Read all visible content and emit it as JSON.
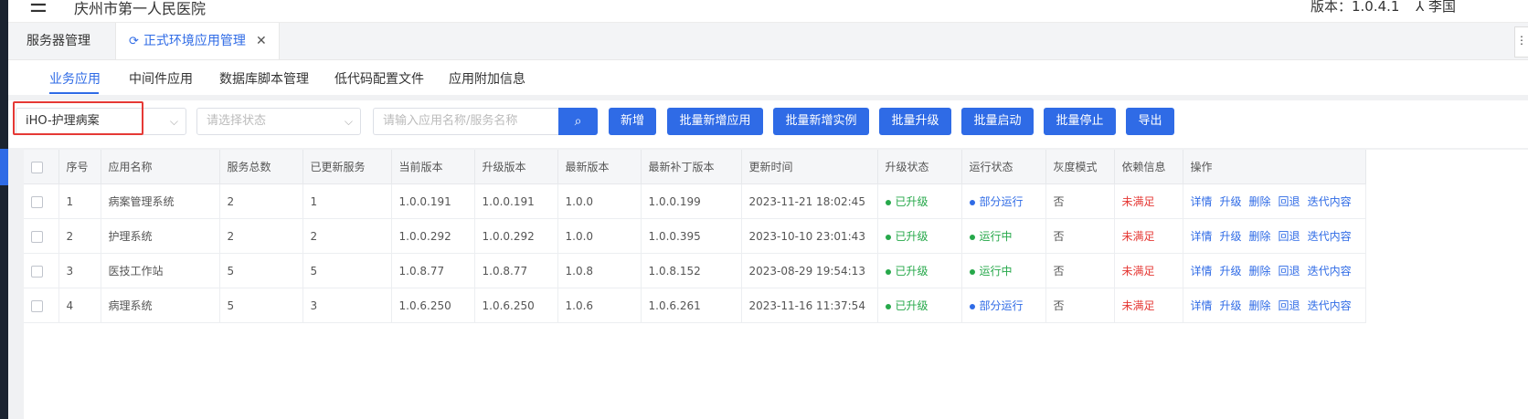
{
  "header": {
    "hospital": "庆州市第一人民医院",
    "version": "版本：1.0.4.1",
    "user": "李国"
  },
  "tabs": [
    {
      "label": "服务器管理"
    },
    {
      "label": "正式环境应用管理"
    }
  ],
  "subtabs": [
    "业务应用",
    "中间件应用",
    "数据库脚本管理",
    "低代码配置文件",
    "应用附加信息"
  ],
  "toolbar": {
    "app_select_value": "iHO-护理病案",
    "status_placeholder": "请选择状态",
    "search_placeholder": "请输入应用名称/服务名称",
    "buttons": [
      "新增",
      "批量新增应用",
      "批量新增实例",
      "批量升级",
      "批量启动",
      "批量停止",
      "导出"
    ]
  },
  "table": {
    "columns": [
      "序号",
      "应用名称",
      "服务总数",
      "已更新服务",
      "当前版本",
      "升级版本",
      "最新版本",
      "最新补丁版本",
      "更新时间",
      "升级状态",
      "运行状态",
      "灰度模式",
      "依赖信息",
      "操作"
    ],
    "rows": [
      {
        "no": "1",
        "name": "病案管理系统",
        "total": "2",
        "updated": "1",
        "current": "1.0.0.191",
        "upgrade": "1.0.0.191",
        "latest": "1.0.0",
        "patch": "1.0.0.199",
        "time": "2023-11-21 18:02:45",
        "upgrade_status": "已升级",
        "run_status": "部分运行",
        "run_status_color": "#2f6be6",
        "gray": "否",
        "dep": "未满足"
      },
      {
        "no": "2",
        "name": "护理系统",
        "total": "2",
        "updated": "2",
        "current": "1.0.0.292",
        "upgrade": "1.0.0.292",
        "latest": "1.0.0",
        "patch": "1.0.0.395",
        "time": "2023-10-10 23:01:43",
        "upgrade_status": "已升级",
        "run_status": "运行中",
        "run_status_color": "#26a84a",
        "gray": "否",
        "dep": "未满足"
      },
      {
        "no": "3",
        "name": "医技工作站",
        "total": "5",
        "updated": "5",
        "current": "1.0.8.77",
        "upgrade": "1.0.8.77",
        "latest": "1.0.8",
        "patch": "1.0.8.152",
        "time": "2023-08-29 19:54:13",
        "upgrade_status": "已升级",
        "run_status": "运行中",
        "run_status_color": "#26a84a",
        "gray": "否",
        "dep": "未满足"
      },
      {
        "no": "4",
        "name": "病理系统",
        "total": "5",
        "updated": "3",
        "current": "1.0.6.250",
        "upgrade": "1.0.6.250",
        "latest": "1.0.6",
        "patch": "1.0.6.261",
        "time": "2023-11-16 11:37:54",
        "upgrade_status": "已升级",
        "run_status": "部分运行",
        "run_status_color": "#2f6be6",
        "gray": "否",
        "dep": "未满足"
      }
    ],
    "row_actions": [
      "详情",
      "升级",
      "删除",
      "回退",
      "迭代内容"
    ]
  },
  "colors": {
    "accent": "#2f6be6",
    "success": "#26a84a",
    "danger": "#e53935"
  }
}
